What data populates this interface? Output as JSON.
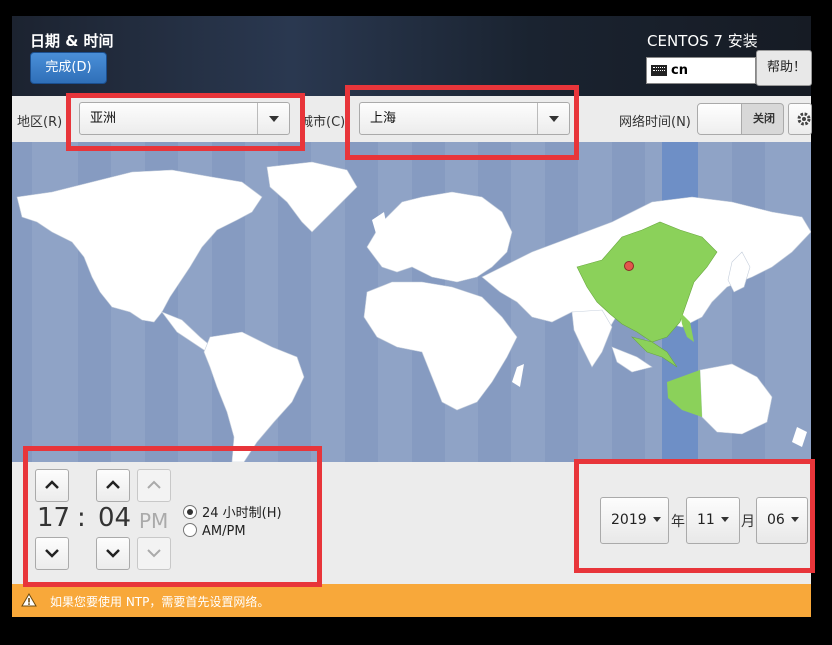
{
  "header": {
    "title": "日期 & 时间",
    "done_label": "完成(D)",
    "product": "CENTOS 7 安装",
    "keyboard_layout": "cn",
    "help_label": "帮助！"
  },
  "toolbar": {
    "region_label": "地区(R)",
    "region_value": "亚洲",
    "city_label": "城市(C)",
    "city_value": "上海",
    "network_time_label": "网络时间(N)",
    "network_time_state": "关闭"
  },
  "map": {
    "selected_timezone": "Asia/Shanghai"
  },
  "time": {
    "hour": "17",
    "separator": ":",
    "minute": "04",
    "ampm": "PM",
    "format_24h_label": "24 小时制(H)",
    "format_ampm_label": "AM/PM",
    "selected_format": "24h"
  },
  "date": {
    "year": "2019",
    "year_unit": "年",
    "month": "11",
    "month_unit": "月",
    "day": "06"
  },
  "warning": {
    "text": "如果您要使用 NTP，需要首先设置网络。"
  },
  "colors": {
    "highlight": "#e8353a",
    "ocean": "#8fa3c6",
    "selected_zone": "#6e8fc6",
    "selected_land": "#8bd15a",
    "warning_bar": "#f8a83a",
    "done_button": "#3d80cc"
  }
}
